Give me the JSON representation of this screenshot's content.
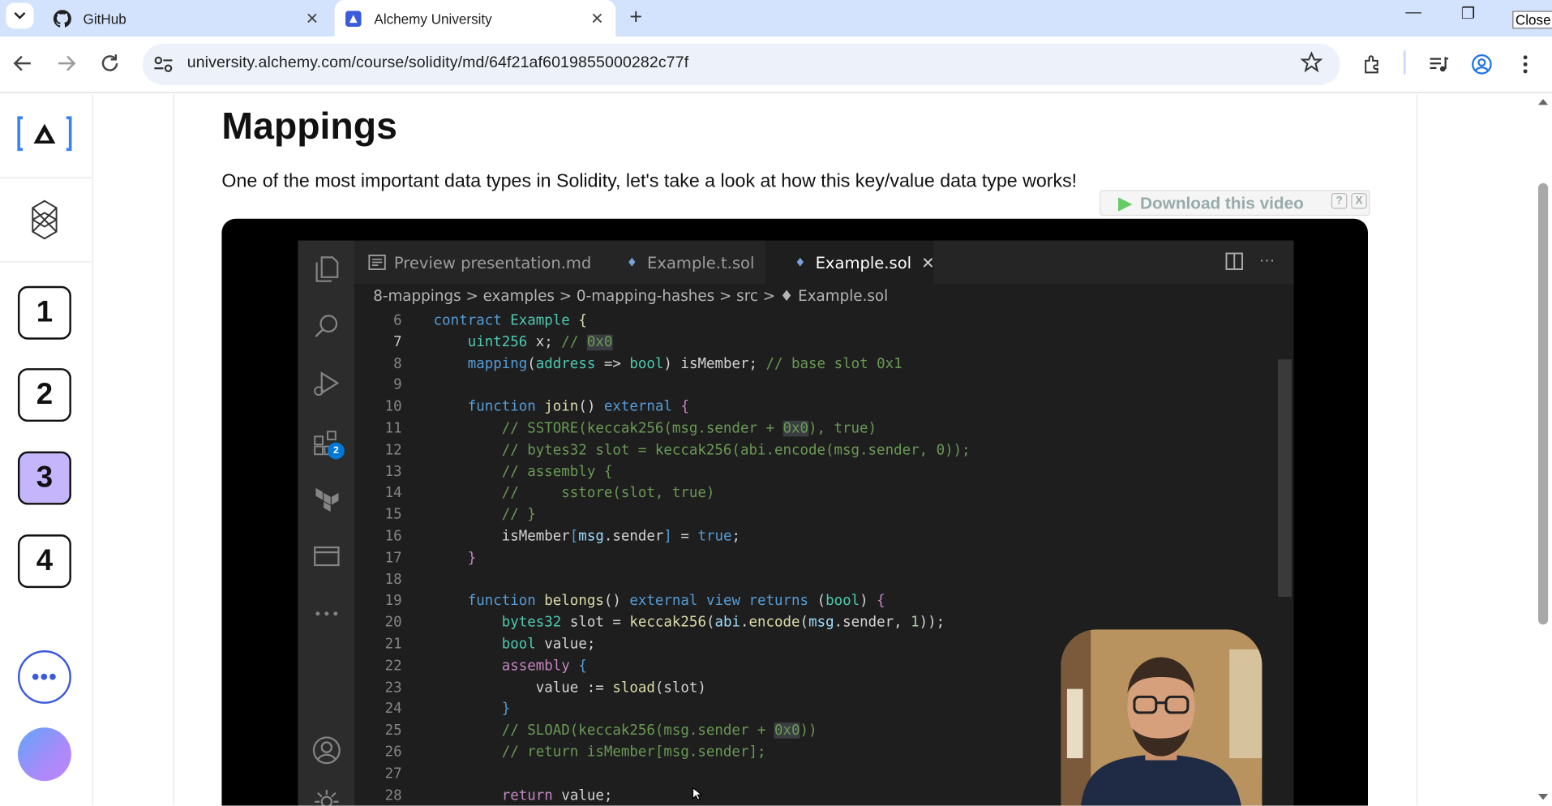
{
  "browser": {
    "tabs": [
      {
        "title": "GitHub",
        "icon": "github-icon",
        "active": false
      },
      {
        "title": "Alchemy University",
        "icon": "alchemy-icon",
        "active": true
      }
    ],
    "tooltip": "Close",
    "url": "university.alchemy.com/course/solidity/md/64f21af6019855000282c77f"
  },
  "sidebar": {
    "logo": "[A]",
    "lessons": [
      "1",
      "2",
      "3",
      "4"
    ],
    "active_lesson": "3",
    "more_label": "•••"
  },
  "page": {
    "title": "Mappings",
    "lead": "One of the most important data types in Solidity, let's take a look at how this key/value data type works!",
    "download_label": "Download this video",
    "download_help": "?",
    "download_close": "X"
  },
  "editor": {
    "tabs": [
      "Preview presentation.md",
      "Example.t.sol",
      "Example.sol"
    ],
    "active_tab": "Example.sol",
    "breadcrumb": "8-mappings > examples > 0-mapping-hashes > src > ♦ Example.sol",
    "extensions_badge": "2",
    "line_numbers": [
      "6",
      "7",
      "8",
      "9",
      "10",
      "11",
      "12",
      "13",
      "14",
      "15",
      "16",
      "17",
      "18",
      "19",
      "20",
      "21",
      "22",
      "23",
      "24",
      "25",
      "26",
      "27",
      "28"
    ],
    "current_line": "7"
  },
  "colors": {
    "accent": "#3b82f6",
    "active_lesson_bg": "#c4b5fd",
    "tabbar_bg": "#d3e3fd",
    "editor_bg": "#1e1e1e"
  }
}
